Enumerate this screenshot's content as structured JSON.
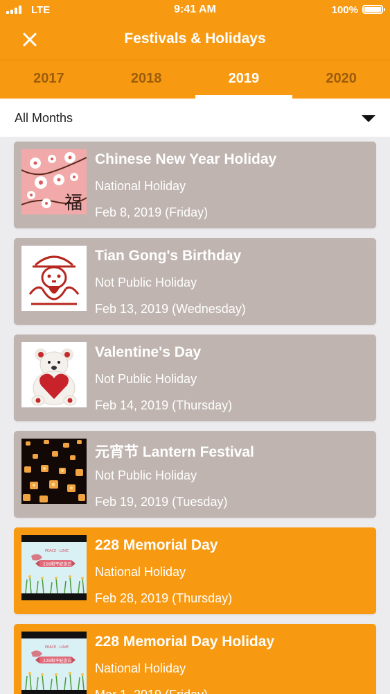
{
  "status_bar": {
    "carrier": "LTE",
    "time": "9:41 AM",
    "battery": "100%"
  },
  "nav": {
    "close_icon": "close-icon",
    "title": "Festivals & Holidays"
  },
  "tabs": [
    {
      "label": "2017",
      "active": false
    },
    {
      "label": "2018",
      "active": false
    },
    {
      "label": "2019",
      "active": true
    },
    {
      "label": "2020",
      "active": false
    }
  ],
  "filter": {
    "selected": "All Months",
    "icon": "dropdown-arrow-icon"
  },
  "colors": {
    "accent": "#f79a12",
    "past_card": "#bfb4af",
    "active_tab_text": "#ffffff",
    "inactive_tab_text": "#9c5c0b"
  },
  "holidays": [
    {
      "title": "Chinese New Year Holiday",
      "type": "National Holiday",
      "date": "Feb 8, 2019 (Friday)",
      "thumbnail": "plum-blossom-fu-image",
      "status": "past"
    },
    {
      "title": "Tian Gong's Birthday",
      "type": "Not Public Holiday",
      "date": "Feb 13, 2019 (Wednesday)",
      "thumbnail": "jade-emperor-papercut-image",
      "status": "past"
    },
    {
      "title": "Valentine's Day",
      "type": "Not Public Holiday",
      "date": "Feb 14, 2019 (Thursday)",
      "thumbnail": "teddy-bear-heart-image",
      "status": "past"
    },
    {
      "title": "元宵节 Lantern Festival",
      "type": "Not Public Holiday",
      "date": "Feb 19, 2019 (Tuesday)",
      "thumbnail": "sky-lanterns-image",
      "status": "past"
    },
    {
      "title": "228 Memorial Day",
      "type": "National Holiday",
      "date": "Feb 28, 2019 (Thursday)",
      "thumbnail": "peace-love-memorial-image",
      "status": "upcoming"
    },
    {
      "title": "228 Memorial Day Holiday",
      "type": "National Holiday",
      "date": "Mar 1, 2019 (Friday)",
      "thumbnail": "peace-love-memorial-image",
      "status": "upcoming"
    }
  ]
}
